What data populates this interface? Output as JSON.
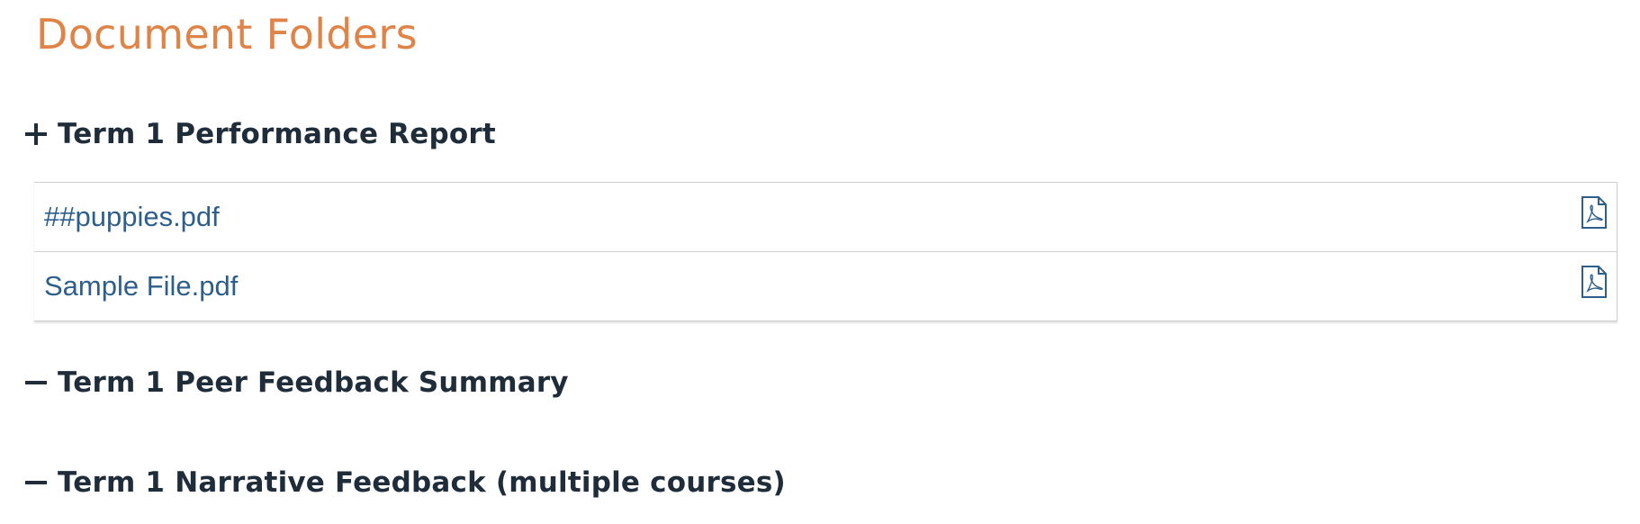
{
  "page": {
    "title": "Document Folders",
    "accent_color": "#e08347"
  },
  "folders": [
    {
      "title": "Term 1 Performance Report",
      "toggle_icon": "plus-icon",
      "files": [
        {
          "name": "##puppies.pdf",
          "icon": "pdf-file-icon"
        },
        {
          "name": "Sample File.pdf",
          "icon": "pdf-file-icon"
        }
      ]
    },
    {
      "title": "Term 1 Peer Feedback Summary",
      "toggle_icon": "minus-icon",
      "files": []
    },
    {
      "title": "Term 1 Narrative Feedback (multiple courses)",
      "toggle_icon": "minus-icon",
      "files": []
    }
  ],
  "colors": {
    "folder_title": "#1f2d3a",
    "file_link": "#2d5f8d",
    "border": "#cfcfcf"
  }
}
